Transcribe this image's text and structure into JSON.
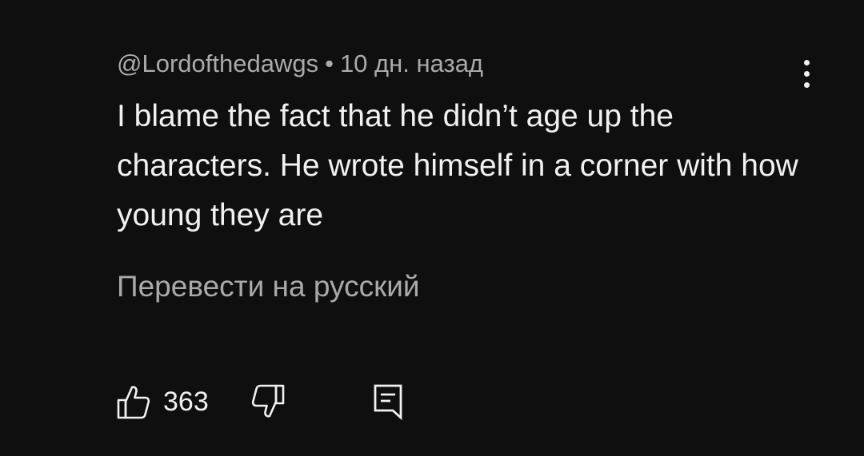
{
  "comment": {
    "author": "@Lordofthedawgs",
    "separator": "•",
    "timestamp": "10 дн. назад",
    "text": "I blame the fact that he didn’t age up the characters. He wrote himself in a corner with how young they are",
    "translate_label": "Перевести на русский",
    "likes": "363"
  },
  "icons": {
    "more": "more-vert-icon",
    "like": "thumb-up-icon",
    "dislike": "thumb-down-icon",
    "reply": "reply-comment-icon"
  },
  "colors": {
    "background": "#0f0f0f",
    "primary_text": "#f1f1f1",
    "secondary_text": "#aaaaaa"
  }
}
